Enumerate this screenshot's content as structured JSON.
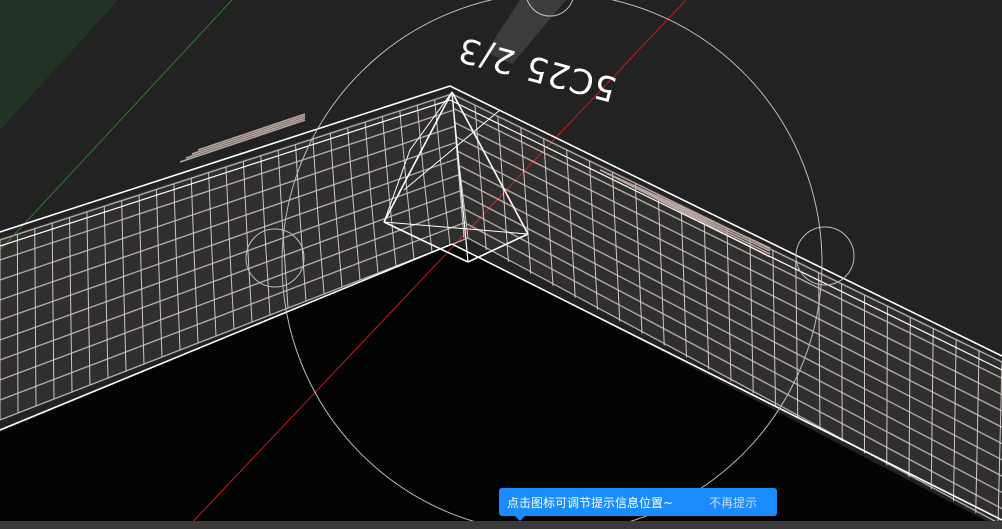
{
  "viewport": {
    "background": "#222222",
    "ground_color": "#233323",
    "inner_floor_color": "#030303",
    "rebar_color": "#b7a6a2",
    "stirrup_color": "#cfc6c3",
    "outline_color": "#ffffff",
    "axis_red": "#c51c1c",
    "axis_green": "#2f7a2f",
    "gizmo_color": "#bdbdbd"
  },
  "rebar_label": "5C25 2/3",
  "tooltip": {
    "message": "点击图标可调节提示信息位置~",
    "dismiss_label": "不再提示",
    "color": "#1a8cff"
  }
}
